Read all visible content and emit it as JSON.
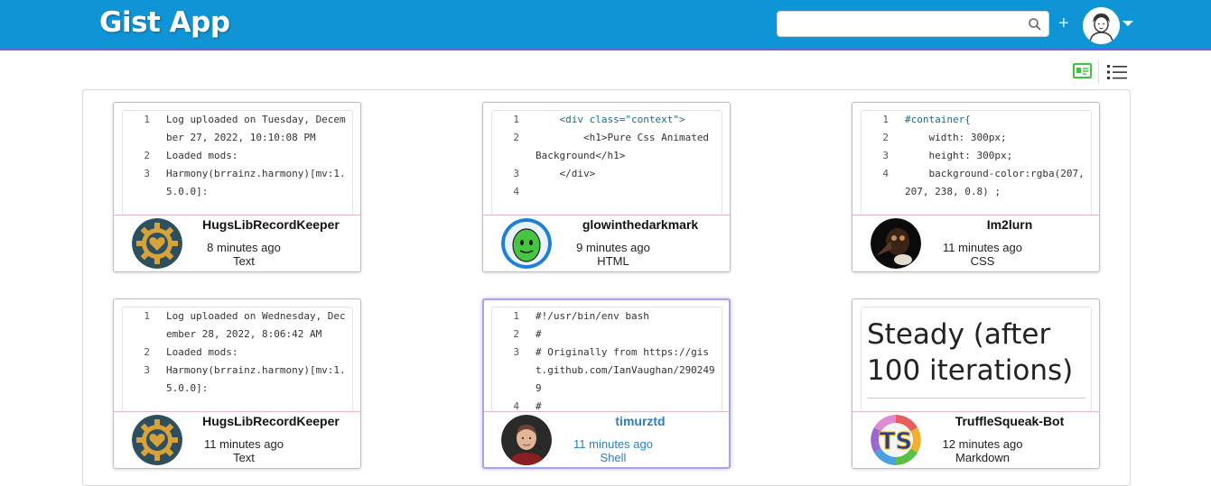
{
  "header": {
    "brand": "Gist App",
    "search_placeholder": "",
    "plus_label": "+"
  },
  "toolbar": {
    "card_view_icon": "id-card-icon",
    "list_view_icon": "list-icon",
    "accent": "#3fc33f"
  },
  "colors": {
    "header_bg": "#0f95d6",
    "selected_border": "#a7a3ef",
    "selected_text": "#2a7fc0"
  },
  "gists": [
    {
      "owner": "HugsLibRecordKeeper",
      "time": "8 minutes ago",
      "language": "Text",
      "avatar": "gear-heart",
      "lines": [
        {
          "n": "1",
          "t": "Log uploaded on Tuesday, December 27, 2022, 10:10:08 PM"
        },
        {
          "n": "2",
          "t": "Loaded mods:"
        },
        {
          "n": "3",
          "t": "Harmony(brrainz.harmony)[mv:1.5.0.0]:"
        }
      ]
    },
    {
      "owner": "glowinthedarkmark",
      "time": "9 minutes ago",
      "language": "HTML",
      "avatar": "green-face",
      "lines": [
        {
          "n": "1",
          "t": "    <div class=\"context\">"
        },
        {
          "n": "2",
          "t": "        <h1>Pure Css Animated Background</h1>"
        },
        {
          "n": "3",
          "t": "    </div>"
        },
        {
          "n": "4",
          "t": ""
        }
      ]
    },
    {
      "owner": "Im2lurn",
      "time": "11 minutes ago",
      "language": "CSS",
      "avatar": "plague-mask",
      "lines": [
        {
          "n": "1",
          "t": "#container{"
        },
        {
          "n": "2",
          "t": "    width: 300px;"
        },
        {
          "n": "3",
          "t": "    height: 300px;"
        },
        {
          "n": "4",
          "t": "    background-color:rgba(207, 207, 238, 0.8) ;"
        }
      ]
    },
    {
      "owner": "HugsLibRecordKeeper",
      "time": "11 minutes ago",
      "language": "Text",
      "avatar": "gear-heart",
      "lines": [
        {
          "n": "1",
          "t": "Log uploaded on Wednesday, December 28, 2022, 8:06:42 AM"
        },
        {
          "n": "2",
          "t": "Loaded mods:"
        },
        {
          "n": "3",
          "t": "Harmony(brrainz.harmony)[mv:1.5.0.0]:"
        }
      ]
    },
    {
      "owner": "timurztd",
      "time": "11 minutes ago",
      "language": "Shell",
      "avatar": "person-photo",
      "selected": true,
      "lines": [
        {
          "n": "1",
          "t": "#!/usr/bin/env bash"
        },
        {
          "n": "2",
          "t": "#"
        },
        {
          "n": "3",
          "t": "# Originally from https://gist.github.com/IanVaughan/2902499"
        },
        {
          "n": "4",
          "t": "#"
        }
      ]
    },
    {
      "owner": "TruffleSqueak-Bot",
      "time": "12 minutes ago",
      "language": "Markdown",
      "avatar": "ts-logo",
      "markdown_title": "Steady (after 100 iterations)"
    }
  ]
}
